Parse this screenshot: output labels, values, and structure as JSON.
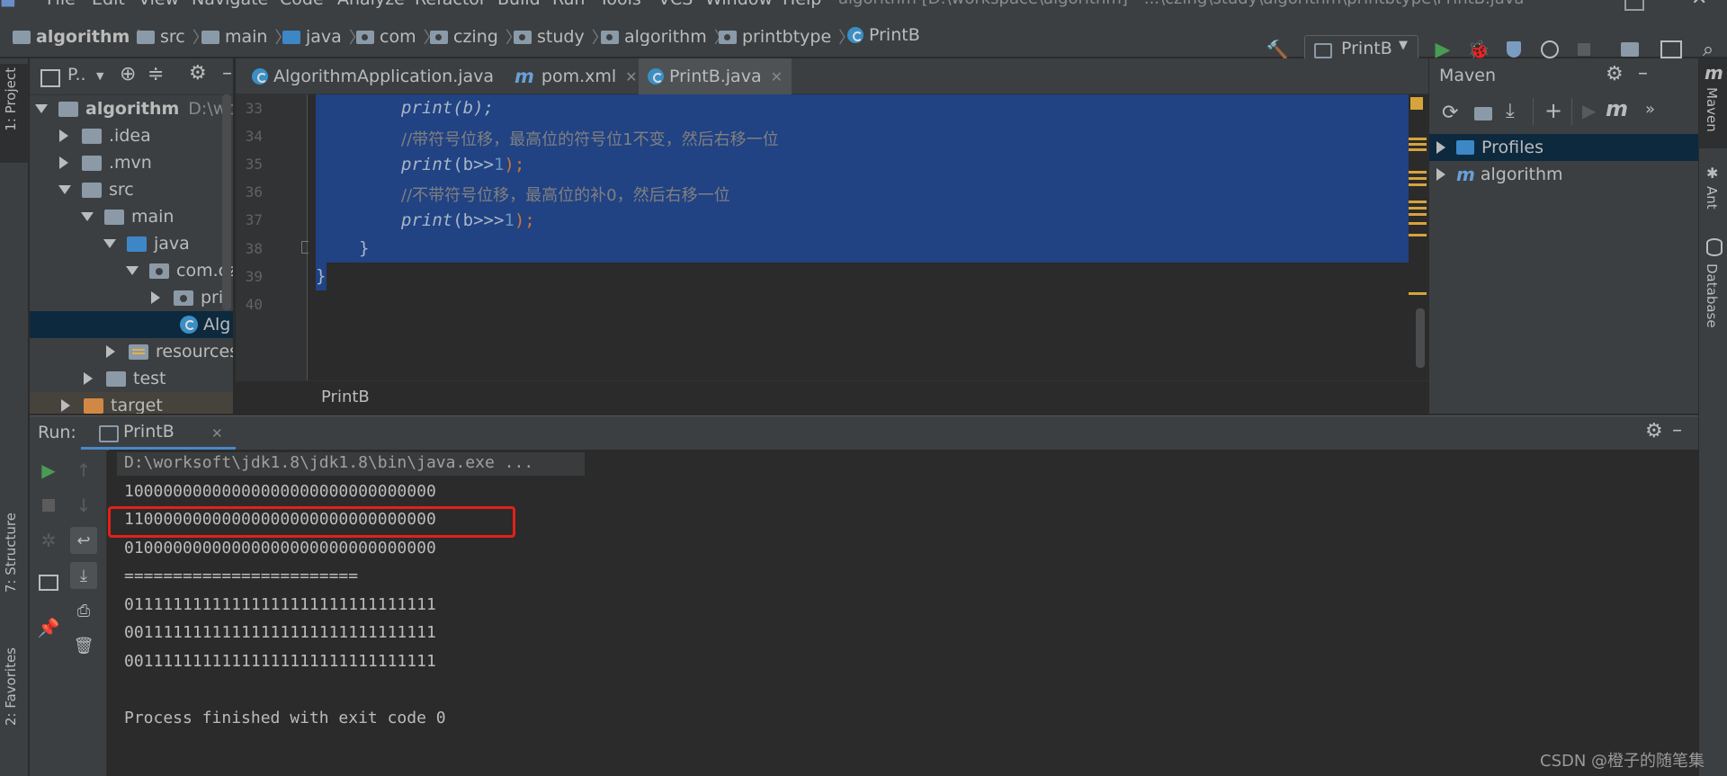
{
  "menu": {
    "items": [
      "File",
      "Edit",
      "View",
      "Navigate",
      "Code",
      "Analyze",
      "Refactor",
      "Build",
      "Run",
      "Tools",
      "VCS",
      "Window",
      "Help"
    ],
    "window_title": "algorithm [D:\\workspace\\algorithm] - ...\\czing\\study\\algorithm\\printbtype\\PrintB.java"
  },
  "navbar": {
    "breadcrumbs": [
      "algorithm",
      "src",
      "main",
      "java",
      "com",
      "czing",
      "study",
      "algorithm",
      "printbtype",
      "PrintB"
    ],
    "run_config": "PrintB"
  },
  "left_stripe": {
    "project_tab": "1: Project",
    "structure_tab": "7: Structure",
    "favorites_tab": "2: Favorites"
  },
  "project": {
    "header_label": "P..",
    "tree": [
      {
        "label": "algorithm",
        "extra": "D:\\work",
        "expanded": true
      },
      {
        "label": ".idea",
        "expanded": false
      },
      {
        "label": ".mvn",
        "expanded": false
      },
      {
        "label": "src",
        "expanded": true
      },
      {
        "label": "main",
        "expanded": true
      },
      {
        "label": "java",
        "expanded": true
      },
      {
        "label": "com.cz",
        "expanded": true
      },
      {
        "label": "prir",
        "expanded": false
      },
      {
        "label": "Alg",
        "selected": true
      },
      {
        "label": "resources",
        "expanded": false
      },
      {
        "label": "test",
        "expanded": false
      },
      {
        "label": "target",
        "expanded": false
      }
    ]
  },
  "editor": {
    "tabs": [
      {
        "label": "AlgorithmApplication.java",
        "active": false
      },
      {
        "label": "pom.xml",
        "active": false
      },
      {
        "label": "PrintB.java",
        "active": true
      }
    ],
    "line_numbers": [
      "33",
      "34",
      "35",
      "36",
      "37",
      "38",
      "39",
      "40"
    ],
    "code": {
      "l33": "print(b);",
      "l34": "//带符号位移，最高位的符号位1不变，然后右移一位",
      "l35_fn": "print",
      "l35_a": "(b>>",
      "l35_n": "1",
      "l35_b": ");",
      "l36": "//不带符号位移，最高位的补0，然后右移一位",
      "l37_fn": "print",
      "l37_a": "(b>>>",
      "l37_n": "1",
      "l37_b": ");",
      "l38": "}",
      "l39": "}"
    },
    "breadcrumb": "PrintB"
  },
  "maven": {
    "title": "Maven",
    "items": [
      {
        "label": "Profiles"
      },
      {
        "label": "algorithm"
      }
    ]
  },
  "right_stripe": {
    "maven_tab": "Maven",
    "ant_tab": "Ant",
    "database_tab": "Database"
  },
  "run": {
    "label": "Run:",
    "tab": "PrintB",
    "output": [
      "D:\\worksoft\\jdk1.8\\jdk1.8\\bin\\java.exe ...",
      "10000000000000000000000000000000",
      "11000000000000000000000000000000",
      "01000000000000000000000000000000",
      "========================",
      "01111111111111111111111111111111",
      "00111111111111111111111111111111",
      "00111111111111111111111111111111",
      "",
      "Process finished with exit code 0"
    ]
  },
  "watermark": "CSDN @橙子的随笔集",
  "colors": {
    "selection": "#214283",
    "accent": "#4a88c7",
    "highlight_box": "#e3201b",
    "run_green": "#499c54"
  }
}
